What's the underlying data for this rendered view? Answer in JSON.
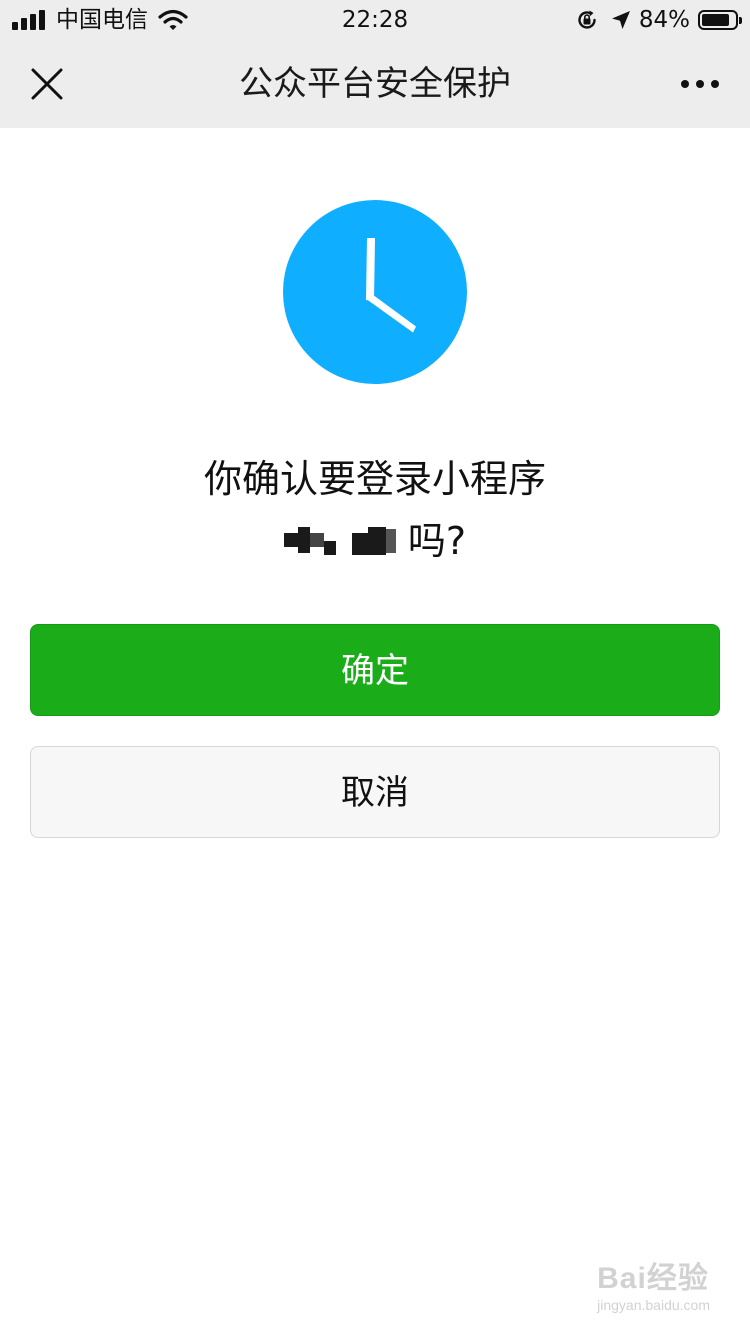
{
  "status_bar": {
    "carrier": "中国电信",
    "time": "22:28",
    "battery_percent": "84%",
    "battery_level": 0.84
  },
  "nav": {
    "title": "公众平台安全保护",
    "close_icon": "close-icon",
    "more_icon": "more-dots-icon"
  },
  "hero": {
    "icon": "clock-icon",
    "icon_color": "#10aeff"
  },
  "prompt": {
    "line1": "你确认要登录小程序",
    "line2_suffix": "吗?"
  },
  "buttons": {
    "confirm_label": "确定",
    "cancel_label": "取消",
    "confirm_color": "#1aad19"
  },
  "watermark": {
    "brand": "Bai经验",
    "url": "jingyan.baidu.com"
  }
}
